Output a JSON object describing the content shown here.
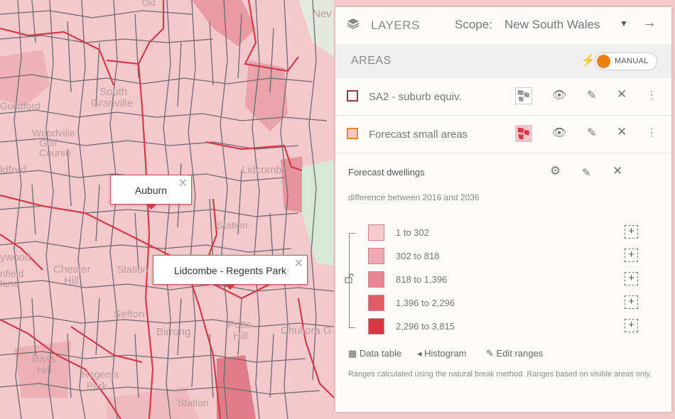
{
  "map": {
    "colors": {
      "fill": "#f3c9cd",
      "boundary_red": "#d23b48",
      "boundary_grey": "#6e6a6e",
      "green": "#d5e6d5"
    },
    "labels": [
      "Auburn",
      "Lidcombe",
      "South",
      "Granville",
      "Chester",
      "Hill",
      "Birrong",
      "Potts",
      "Hill",
      "Chullora G",
      "Bass",
      "Hill",
      "Regents",
      "Park",
      "Station",
      "Guildford",
      "Woodville",
      "Golf",
      "Course",
      "ldford",
      "ywood",
      "nfield",
      "lane",
      "Station",
      "Station",
      "Sefton",
      "Nev"
    ],
    "popups": [
      {
        "text": "Auburn",
        "close": "✕"
      },
      {
        "text": "Lidcombe - Regents Park",
        "close": "✕"
      }
    ]
  },
  "panel": {
    "header": {
      "icon": "layers-icon",
      "title": "LAYERS",
      "scope_label": "Scope:",
      "scope_value": "New South Wales",
      "caret": "▼",
      "go": "→"
    },
    "areas": {
      "title": "AREAS",
      "mode": "MANUAL",
      "bolt": "⚡",
      "accent": "#f07f0f"
    },
    "layers": [
      {
        "name": "SA2 - suburb equiv.",
        "symbol_border": "#a8323f",
        "symbol_fill": "#ffffff"
      },
      {
        "name": "Forecast small areas",
        "symbol_border": "#e08a2c",
        "symbol_fill": "#f4c7c9"
      }
    ],
    "forecast": {
      "title": "Forecast dwellings",
      "subtitle": "difference between 2016 and 2036",
      "legend": [
        {
          "range": "1 to 302",
          "color": "#f6cace"
        },
        {
          "range": "302  to  818",
          "color": "#f1a9b1"
        },
        {
          "range": "818  to  1,396",
          "color": "#ea8691"
        },
        {
          "range": "1,396  to  2,296",
          "color": "#e05a68"
        },
        {
          "range": "2,296  to  3,815",
          "color": "#d93645"
        }
      ],
      "tools": {
        "data_table": "Data table",
        "histogram": "Histogram",
        "edit_ranges": "Edit ranges"
      },
      "note": "Ranges calculated using the natural break method. Ranges based on visible areas only."
    }
  }
}
